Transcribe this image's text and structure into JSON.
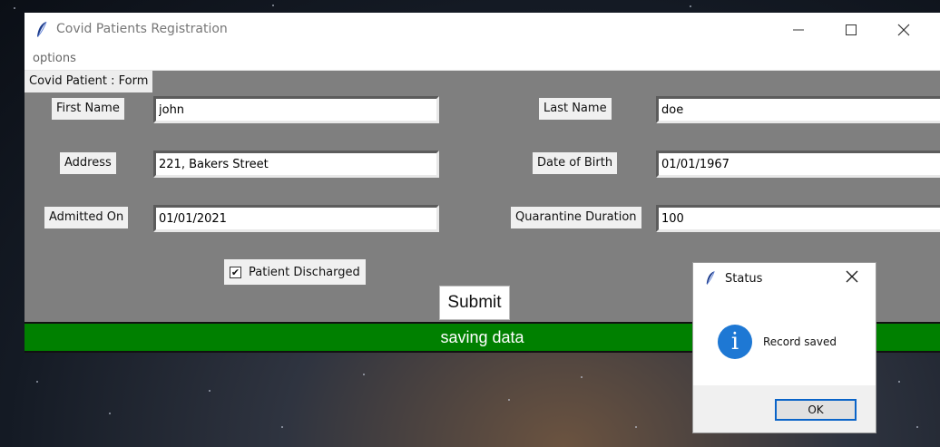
{
  "window": {
    "title": "Covid Patients Registration",
    "menu": [
      "options"
    ]
  },
  "form": {
    "tab_label": "Covid Patient : Form",
    "fields": {
      "first_name": {
        "label": "First Name",
        "value": "john"
      },
      "last_name": {
        "label": "Last Name",
        "value": "doe"
      },
      "address": {
        "label": "Address",
        "value": "221, Bakers Street"
      },
      "date_of_birth": {
        "label": "Date of Birth",
        "value": "01/01/1967"
      },
      "admitted_on": {
        "label": "Admitted On",
        "value": "01/01/2021"
      },
      "quarantine_duration": {
        "label": "Quarantine Duration",
        "value": "100"
      }
    },
    "discharged": {
      "label": "Patient Discharged",
      "checked": true,
      "mark": "✔"
    },
    "submit_label": "Submit"
  },
  "status_bar": {
    "text": "saving data",
    "color": "#008000"
  },
  "dialog": {
    "title": "Status",
    "message": "Record saved",
    "info_glyph": "i",
    "ok_label": "OK",
    "icon_color": "#1e78d4"
  },
  "icons": [
    "feather-icon",
    "minimize-icon",
    "maximize-icon",
    "close-icon",
    "info-icon",
    "checkmark-icon"
  ]
}
